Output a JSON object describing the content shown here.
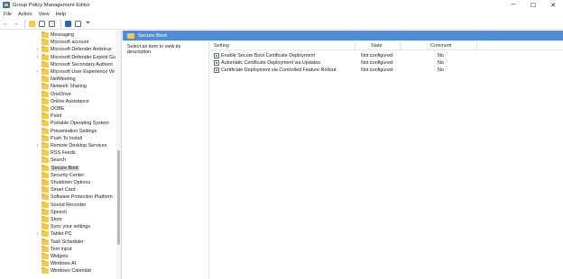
{
  "window": {
    "title": "Group Policy Management Editor",
    "min_glyph": "─",
    "max_glyph": "☐",
    "close_glyph": "✕"
  },
  "menu": [
    "File",
    "Action",
    "View",
    "Help"
  ],
  "toolbar": {
    "icons": [
      "back-arrow-icon",
      "forward-arrow-icon",
      "folder-up-icon",
      "show-hide-tree-icon",
      "export-list-icon",
      "help-icon",
      "properties-icon",
      "filter-icon"
    ],
    "back_glyph": "←",
    "forward_glyph": "→",
    "filter_glyph": "⏷"
  },
  "tree": {
    "items": [
      {
        "label": "Messaging",
        "expandable": false
      },
      {
        "label": "Microsoft account",
        "expandable": false
      },
      {
        "label": "Microsoft Defender Antivirus",
        "expandable": true
      },
      {
        "label": "Microsoft Defender Exploit Gu",
        "expandable": true
      },
      {
        "label": "Microsoft Secondary Authent",
        "expandable": false
      },
      {
        "label": "Microsoft User Experience Vir",
        "expandable": true
      },
      {
        "label": "NetMeeting",
        "expandable": false
      },
      {
        "label": "Network Sharing",
        "expandable": false
      },
      {
        "label": "OneDrive",
        "expandable": false
      },
      {
        "label": "Online Assistance",
        "expandable": false
      },
      {
        "label": "OOBE",
        "expandable": false
      },
      {
        "label": "Paint",
        "expandable": false
      },
      {
        "label": "Portable Operating System",
        "expandable": false
      },
      {
        "label": "Presentation Settings",
        "expandable": false
      },
      {
        "label": "Push To Install",
        "expandable": false
      },
      {
        "label": "Remote Desktop Services",
        "expandable": true
      },
      {
        "label": "RSS Feeds",
        "expandable": false
      },
      {
        "label": "Search",
        "expandable": false
      },
      {
        "label": "Secure Boot",
        "expandable": false,
        "selected": true
      },
      {
        "label": "Security Center",
        "expandable": false
      },
      {
        "label": "Shutdown Options",
        "expandable": false
      },
      {
        "label": "Smart Card",
        "expandable": false
      },
      {
        "label": "Software Protection Platform",
        "expandable": false
      },
      {
        "label": "Sound Recorder",
        "expandable": false
      },
      {
        "label": "Speech",
        "expandable": false
      },
      {
        "label": "Store",
        "expandable": false
      },
      {
        "label": "Sync your settings",
        "expandable": false
      },
      {
        "label": "Tablet PC",
        "expandable": true
      },
      {
        "label": "Task Scheduler",
        "expandable": false
      },
      {
        "label": "Text Input",
        "expandable": false
      },
      {
        "label": "Widgets",
        "expandable": false
      },
      {
        "label": "Windows AI",
        "expandable": false
      },
      {
        "label": "Windows Calendar",
        "expandable": false
      }
    ]
  },
  "right_pane": {
    "header_title": "Secure Boot",
    "description": "Select an item to view its description.",
    "columns": {
      "setting": "Setting",
      "state": "State",
      "comment": "Comment"
    },
    "rows": [
      {
        "setting": "Enable Secure Boot Certificate Deployment",
        "state": "Not configured",
        "comment": "No"
      },
      {
        "setting": "Automatic Certificate Deployment via Updates",
        "state": "Not configured",
        "comment": "No"
      },
      {
        "setting": "Certificate Deployment via Controlled Feature Rollout",
        "state": "Not configured",
        "comment": "No"
      }
    ]
  },
  "colors": {
    "header_blue": "#4f8ed6",
    "folder_yellow": "#f3c94f",
    "selection_gray": "#d9d9d9"
  }
}
